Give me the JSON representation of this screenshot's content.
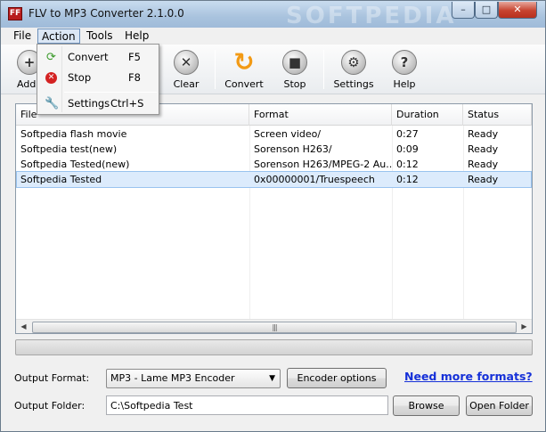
{
  "window": {
    "title": "FLV to MP3 Converter 2.1.0.0",
    "app_icon_text": "FF",
    "watermark": "SOFTPEDIA",
    "min": "–",
    "max": "□",
    "close": "✕"
  },
  "menu": {
    "file": "File",
    "action": "Action",
    "tools": "Tools",
    "help": "Help"
  },
  "dropdown": {
    "items": [
      {
        "label": "Convert",
        "shortcut": "F5",
        "icon": "convert-icon"
      },
      {
        "label": "Stop",
        "shortcut": "F8",
        "icon": "stop-icon"
      },
      {
        "label": "Settings",
        "shortcut": "Ctrl+S",
        "icon": "wrench-icon"
      }
    ]
  },
  "toolbar": {
    "add": "Add",
    "clear": "Clear",
    "convert": "Convert",
    "stop": "Stop",
    "settings": "Settings",
    "help": "Help"
  },
  "table": {
    "columns": [
      "File",
      "Format",
      "Duration",
      "Status"
    ],
    "rows": [
      {
        "file": "Softpedia flash movie",
        "format": "Screen video/",
        "duration": "0:27",
        "status": "Ready"
      },
      {
        "file": "Softpedia test(new)",
        "format": "Sorenson H263/",
        "duration": "0:09",
        "status": "Ready"
      },
      {
        "file": "Softpedia Tested(new)",
        "format": "Sorenson H263/MPEG-2 Au...",
        "duration": "0:12",
        "status": "Ready"
      },
      {
        "file": "Softpedia Tested",
        "format": "0x00000001/Truespeech",
        "duration": "0:12",
        "status": "Ready"
      }
    ],
    "selected_row": 3,
    "scroll_left": "◀",
    "scroll_right": "▶",
    "scroll_grip": "|||"
  },
  "progress": {
    "value": 0
  },
  "form": {
    "output_format_label": "Output Format:",
    "output_format_value": "MP3 - Lame MP3 Encoder",
    "encoder_options": "Encoder options",
    "more_formats_link": "Need more formats?",
    "output_folder_label": "Output Folder:",
    "output_folder_value": "C:\\Softpedia Test",
    "browse": "Browse",
    "open_folder": "Open Folder"
  },
  "colors": {
    "link": "#1530d8",
    "selection": "#dcebfc",
    "convert_icon": "#f29a15"
  }
}
